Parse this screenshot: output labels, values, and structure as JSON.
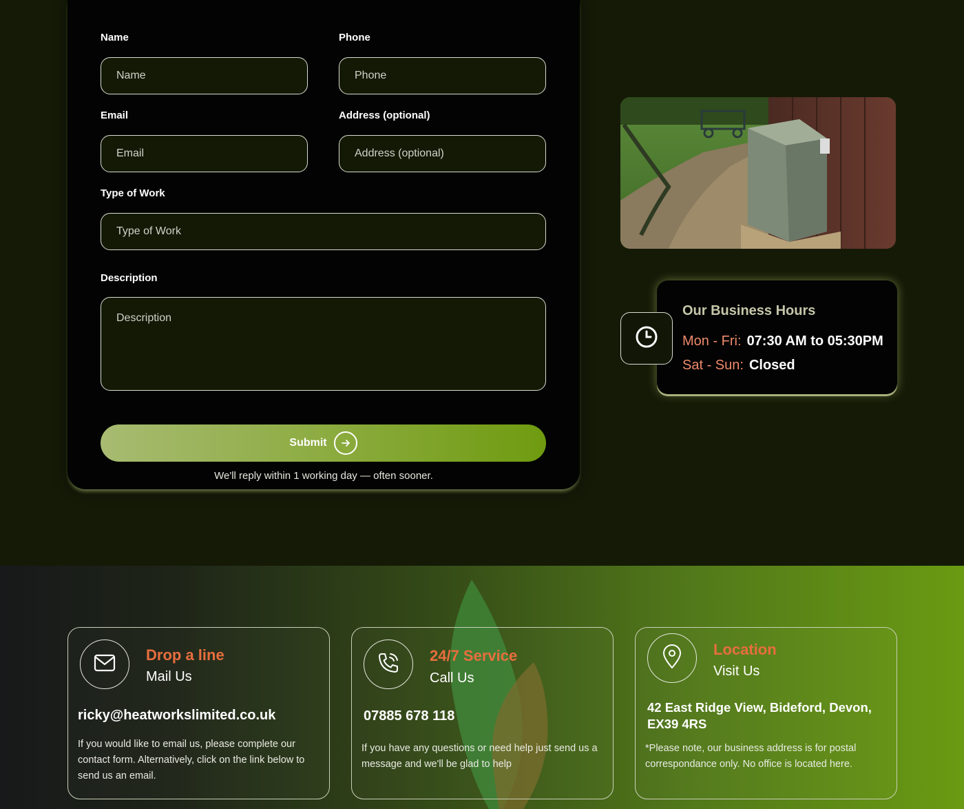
{
  "form": {
    "name_label": "Name",
    "name_placeholder": "Name",
    "phone_label": "Phone",
    "phone_placeholder": "Phone",
    "email_label": "Email",
    "email_placeholder": "Email",
    "address_label": "Address (optional)",
    "address_placeholder": "Address (optional)",
    "work_label": "Type of Work",
    "work_placeholder": "Type of Work",
    "description_label": "Description",
    "description_placeholder": "Description",
    "submit_label": "Submit",
    "reply_note": "We'll reply within 1 working day — often sooner."
  },
  "hours": {
    "title": "Our Business Hours",
    "weekday_label": "Mon - Fri:",
    "weekday_value": "07:30 AM to 05:30PM",
    "weekend_label": "Sat - Sun:",
    "weekend_value": "Closed"
  },
  "contact": {
    "mail": {
      "kicker": "Drop a line",
      "subtitle": "Mail Us",
      "value": "ricky@heatworkslimited.co.uk",
      "description": "If you would like to email us, please complete our contact form. Alternatively, click on the link below to send us an email."
    },
    "phone": {
      "kicker": "24/7 Service",
      "subtitle": "Call Us",
      "value": "07885 678 118",
      "description": "If you have any questions or need help just send us a message and we'll be glad to help"
    },
    "location": {
      "kicker": "Location",
      "subtitle": "Visit Us",
      "value": "42 East Ridge View, Bideford, Devon, EX39 4RS",
      "description": "*Please note, our business address is for postal correspondance only. No office is located here."
    }
  },
  "colors": {
    "accent_orange": "#e86e3e",
    "accent_green": "#6f9b10",
    "page_background": "#151a07",
    "day_label": "#f08a6c"
  },
  "icons": [
    "clock-icon",
    "arrow-right-icon",
    "mail-icon",
    "phone-icon",
    "location-pin-icon",
    "flame-icon"
  ]
}
